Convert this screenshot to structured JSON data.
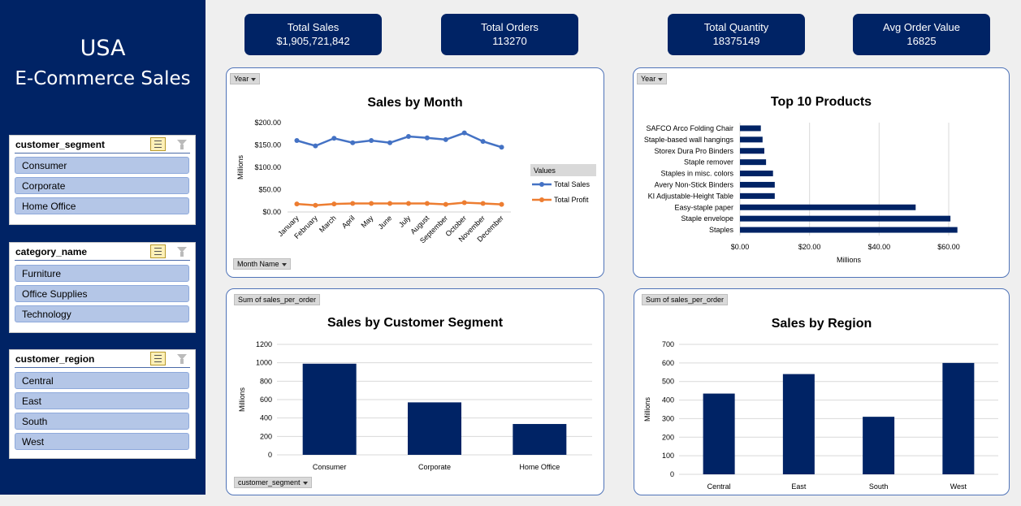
{
  "sidebar": {
    "title_line1": "USA",
    "title_line2": "E-Commerce Sales",
    "slicers": [
      {
        "title": "customer_segment",
        "items": [
          "Consumer",
          "Corporate",
          "Home Office"
        ]
      },
      {
        "title": "category_name",
        "items": [
          "Furniture",
          "Office Supplies",
          "Technology"
        ]
      },
      {
        "title": "customer_region",
        "items": [
          "Central",
          "East",
          "South",
          "West"
        ]
      }
    ]
  },
  "kpis": [
    {
      "label": "Total Sales",
      "value": "$1,905,721,842"
    },
    {
      "label": "Total Orders",
      "value": "113270"
    },
    {
      "label": "Total Quantity",
      "value": "18375149"
    },
    {
      "label": "Avg Order Value",
      "value": "16825"
    }
  ],
  "field_buttons": {
    "year": "Year",
    "month_name": "Month Name",
    "sum_sales_per_order": "Sum of sales_per_order",
    "customer_segment": "customer_segment"
  },
  "colors": {
    "navy": "#002365",
    "total_sales": "#4472c4",
    "total_profit": "#ed7d31",
    "bar": "#002365"
  },
  "chart_data": [
    {
      "type": "line",
      "title": "Sales by Month",
      "ylabel": "Millions",
      "legend_title": "Values",
      "legend_position": "right",
      "categories": [
        "January",
        "February",
        "March",
        "April",
        "May",
        "June",
        "July",
        "August",
        "September",
        "October",
        "November",
        "December"
      ],
      "y_ticks": [
        "$0.00",
        "$50.00",
        "$100.00",
        "$150.00",
        "$200.00"
      ],
      "ylim": [
        0,
        200
      ],
      "grid": false,
      "series": [
        {
          "name": "Total Sales",
          "values": [
            160,
            148,
            165,
            155,
            160,
            155,
            169,
            166,
            162,
            177,
            158,
            145
          ]
        },
        {
          "name": "Total Profit",
          "values": [
            18,
            15,
            18,
            19,
            19,
            19,
            19,
            19,
            17,
            21,
            19,
            17
          ]
        }
      ]
    },
    {
      "type": "bar",
      "orientation": "horizontal",
      "title": "Top 10 Products",
      "xlabel": "Millions",
      "x_ticks": [
        "$0.00",
        "$20.00",
        "$40.00",
        "$60.00"
      ],
      "xlim": [
        0,
        60
      ],
      "grid": true,
      "categories": [
        "SAFCO Arco Folding Chair",
        "Staple-based wall hangings",
        "Storex Dura Pro Binders",
        "Staple remover",
        "Staples in misc. colors",
        "Avery Non-Stick Binders",
        "KI Adjustable-Height Table",
        "Easy-staple paper",
        "Staple envelope",
        "Staples"
      ],
      "values": [
        6,
        6.5,
        7,
        7.5,
        9.5,
        10,
        10,
        50.5,
        60.5,
        62.5
      ]
    },
    {
      "type": "bar",
      "title": "Sales by Customer Segment",
      "ylabel": "Millions",
      "y_ticks": [
        "0",
        "200",
        "400",
        "600",
        "800",
        "1000",
        "1200"
      ],
      "ylim": [
        0,
        1200
      ],
      "grid": true,
      "categories": [
        "Consumer",
        "Corporate",
        "Home Office"
      ],
      "values": [
        990,
        570,
        335
      ]
    },
    {
      "type": "bar",
      "title": "Sales by Region",
      "ylabel": "Millions",
      "y_ticks": [
        "0",
        "100",
        "200",
        "300",
        "400",
        "500",
        "600",
        "700"
      ],
      "ylim": [
        0,
        700
      ],
      "grid": true,
      "categories": [
        "Central",
        "East",
        "South",
        "West"
      ],
      "values": [
        435,
        540,
        310,
        600
      ]
    }
  ]
}
